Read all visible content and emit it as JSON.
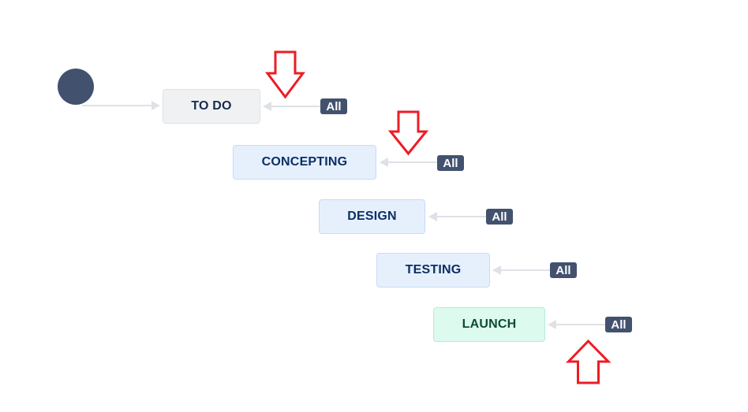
{
  "diagram": {
    "type": "workflow",
    "start_node": "start",
    "statuses": [
      {
        "id": "todo",
        "label": "TO DO",
        "category": "todo",
        "color": "#f0f1f3",
        "transition_label": "All"
      },
      {
        "id": "concepting",
        "label": "CONCEPTING",
        "category": "in-progress",
        "color": "#e6f0fd",
        "transition_label": "All"
      },
      {
        "id": "design",
        "label": "DESIGN",
        "category": "in-progress",
        "color": "#e6f0fd",
        "transition_label": "All"
      },
      {
        "id": "testing",
        "label": "TESTING",
        "category": "in-progress",
        "color": "#e6f0fd",
        "transition_label": "All"
      },
      {
        "id": "launch",
        "label": "LAUNCH",
        "category": "done",
        "color": "#dcfaee",
        "transition_label": "All"
      }
    ],
    "annotations": [
      {
        "type": "red-arrow-down",
        "points_to": "todo-all-transition",
        "color": "#ed1c24"
      },
      {
        "type": "red-arrow-down",
        "points_to": "concepting-all-transition",
        "color": "#ed1c24"
      },
      {
        "type": "red-arrow-up",
        "points_to": "launch-all-transition",
        "color": "#ed1c24"
      }
    ],
    "colors": {
      "start_node": "#42526e",
      "badge": "#42526e",
      "connector": "#dfe1e6"
    }
  }
}
